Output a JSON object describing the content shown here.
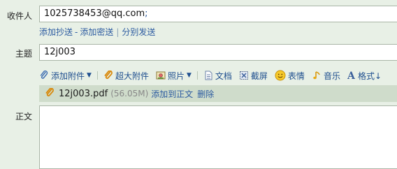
{
  "to": {
    "label": "收件人",
    "value": "1025738453@qq.com",
    "separator": ";"
  },
  "cc_links": {
    "add_cc": "添加抄送",
    "dash": "-",
    "add_bcc": "添加密送",
    "divider": "|",
    "separate_send": "分别发送"
  },
  "subject": {
    "label": "主题",
    "value": "12j003"
  },
  "toolbar": {
    "add_attachment": "添加附件",
    "large_attachment": "超大附件",
    "photo": "照片",
    "document": "文档",
    "screenshot": "截屏",
    "emoji": "表情",
    "music": "音乐",
    "format": "格式↓"
  },
  "attachment": {
    "filename": "12j003.pdf",
    "size": "(56.05M)",
    "add_to_body": "添加到正文",
    "delete": "删除"
  },
  "body": {
    "label": "正文"
  },
  "colors": {
    "background": "#e8f0e6",
    "link": "#2b5aa0",
    "attach_bar": "#cfdccb"
  }
}
